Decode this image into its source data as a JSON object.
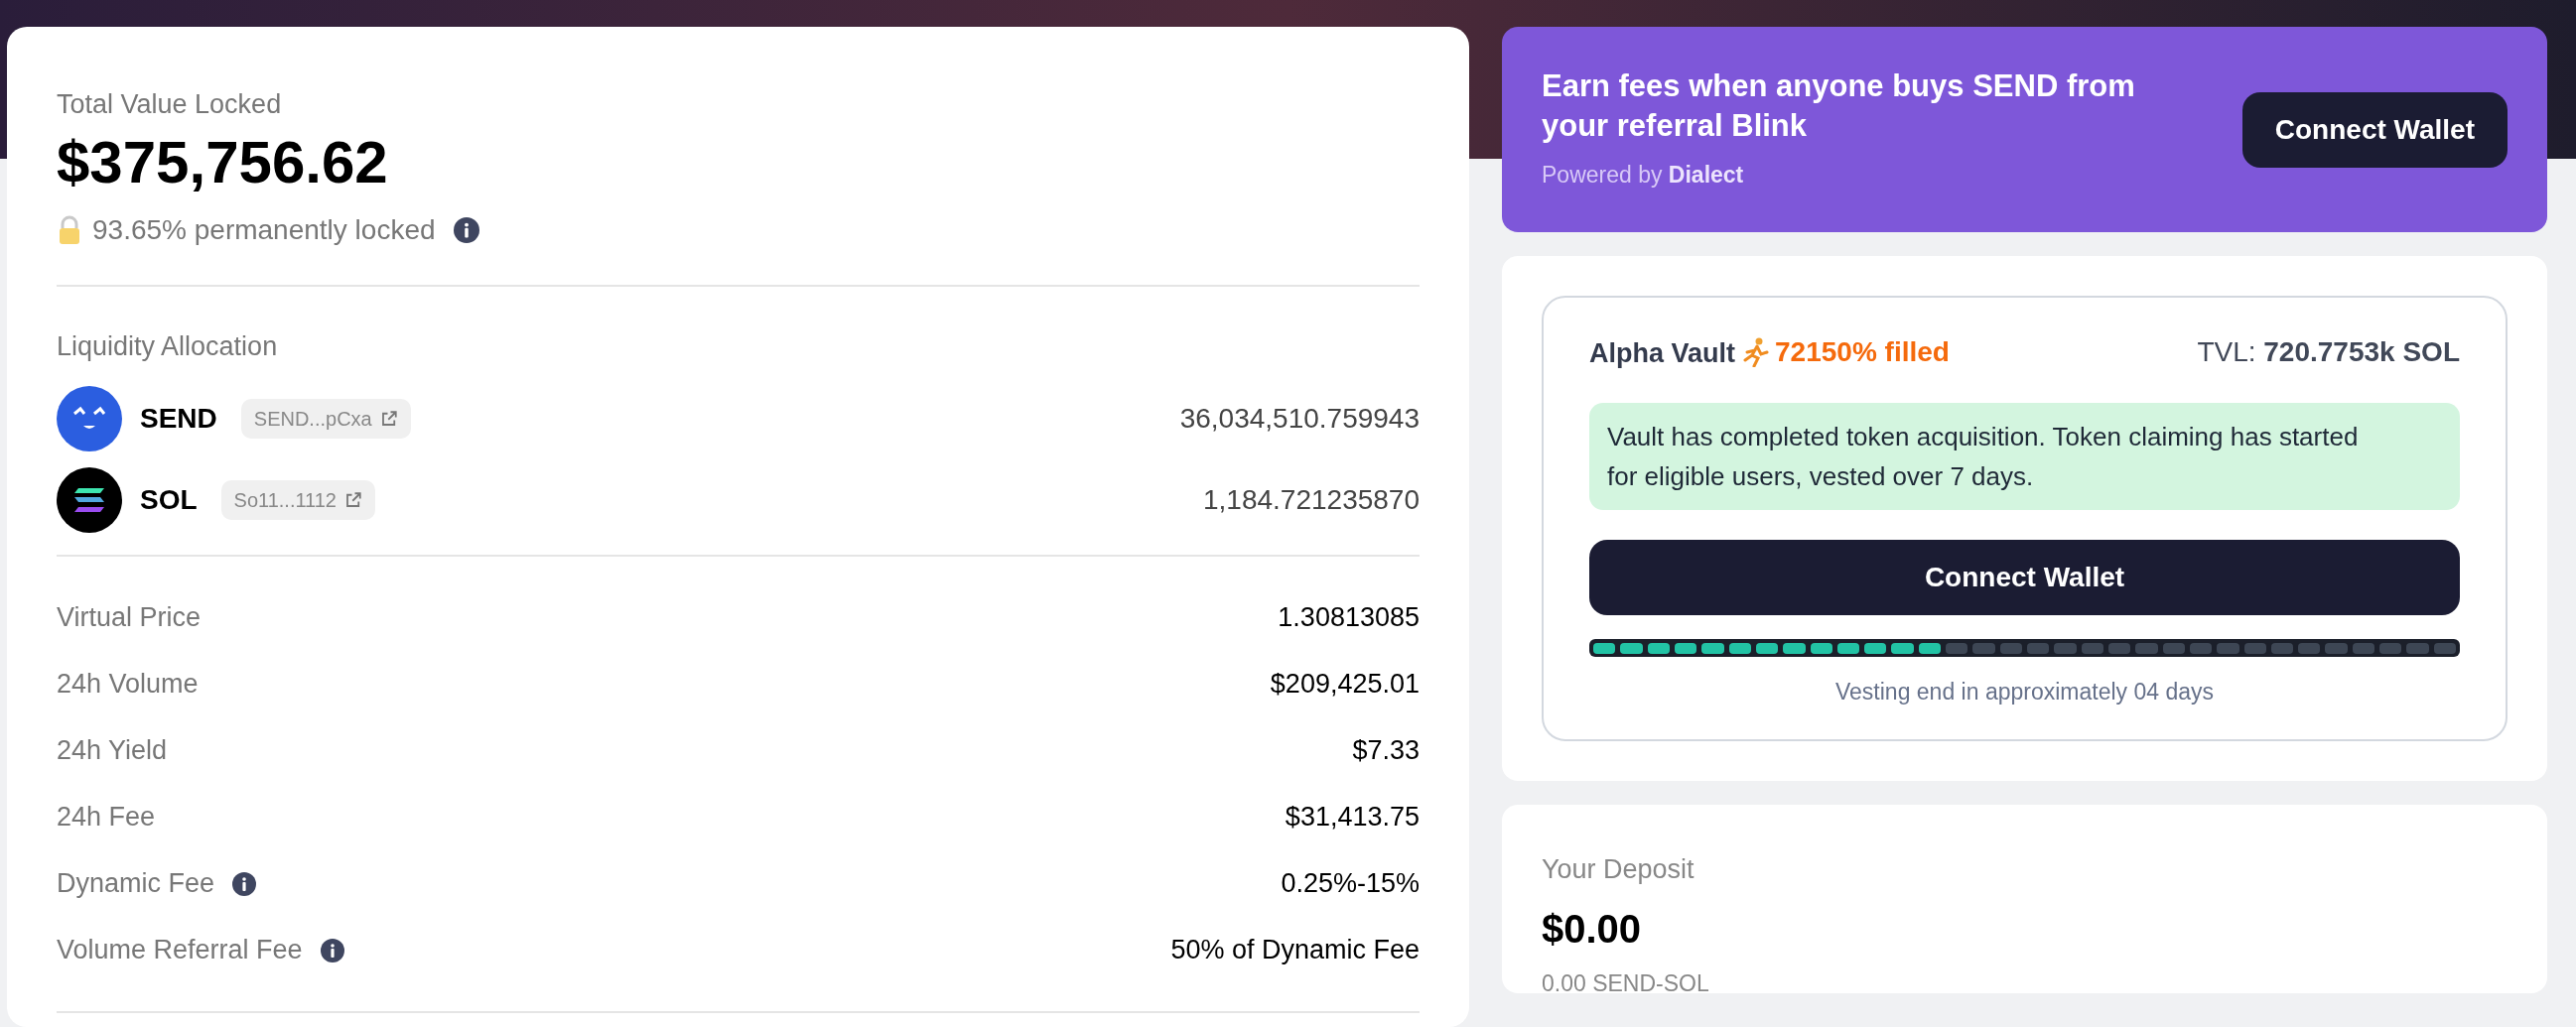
{
  "tvl": {
    "label": "Total Value Locked",
    "value": "$375,756.62",
    "locked_note": "93.65% permanently locked"
  },
  "liquidity": {
    "title": "Liquidity Allocation",
    "tokens": [
      {
        "symbol": "SEND",
        "address": "SEND...pCxa",
        "amount": "36,034,510.759943",
        "kind": "send"
      },
      {
        "symbol": "SOL",
        "address": "So11...1112",
        "amount": "1,184.721235870",
        "kind": "sol"
      }
    ]
  },
  "stats": [
    {
      "label": "Virtual Price",
      "value": "1.30813085",
      "info": false
    },
    {
      "label": "24h Volume",
      "value": "$209,425.01",
      "info": false
    },
    {
      "label": "24h Yield",
      "value": "$7.33",
      "info": false
    },
    {
      "label": "24h Fee",
      "value": "$31,413.75",
      "info": false
    },
    {
      "label": "Dynamic Fee",
      "value": "0.25%-15%",
      "info": true
    },
    {
      "label": "Volume Referral Fee",
      "value": "50% of Dynamic Fee",
      "info": true
    }
  ],
  "referral_banner": {
    "title": "Earn fees when anyone buys SEND from your referral Blink",
    "powered_by": "Powered by **Dialect**",
    "button": "Connect Wallet"
  },
  "alpha_vault": {
    "title": "Alpha Vault",
    "filled": "72150% filled",
    "tvl_label": "TVL:",
    "tvl_value": "720.7753k SOL",
    "notice": "Vault has completed token acquisition. Token claiming has started for eligible users, vested over 7 days.",
    "button": "Connect Wallet",
    "vesting": {
      "level": 0.406
    },
    "vesting_note": "Vesting end in approximately 04 days"
  },
  "deposit": {
    "label": "Your Deposit",
    "value": "$0.00",
    "amount": "0.00 SEND-SOL"
  }
}
